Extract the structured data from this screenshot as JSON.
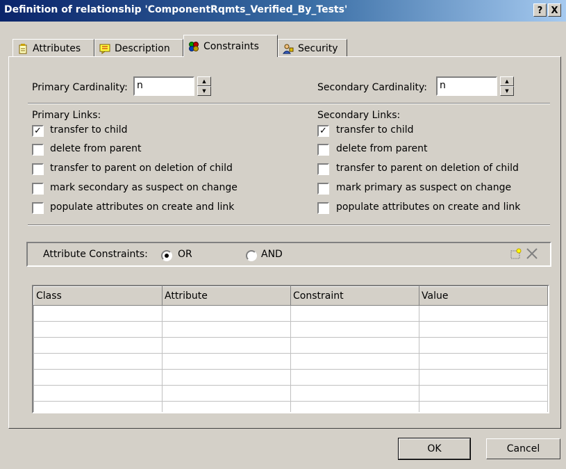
{
  "window": {
    "title": "Definition of relationship 'ComponentRqmts_Verified_By_Tests'",
    "help_label": "?",
    "close_label": "X"
  },
  "tabs": [
    {
      "label": "Attributes",
      "icon": "attributes-icon"
    },
    {
      "label": "Description",
      "icon": "description-icon"
    },
    {
      "label": "Constraints",
      "icon": "constraints-icon",
      "active": true
    },
    {
      "label": "Security",
      "icon": "security-icon"
    }
  ],
  "primary": {
    "cardinality_label": "Primary Cardinality:",
    "cardinality_value": "n",
    "links_label": "Primary Links:",
    "links": [
      {
        "label": "transfer to child",
        "checked": true
      },
      {
        "label": "delete from parent",
        "checked": false
      },
      {
        "label": "transfer to parent on deletion of child",
        "checked": false
      },
      {
        "label": "mark secondary as suspect on change",
        "checked": false
      },
      {
        "label": "populate attributes on create and link",
        "checked": false
      }
    ]
  },
  "secondary": {
    "cardinality_label": "Secondary Cardinality:",
    "cardinality_value": "n",
    "links_label": "Secondary Links:",
    "links": [
      {
        "label": "transfer to child",
        "checked": true
      },
      {
        "label": "delete from parent",
        "checked": false
      },
      {
        "label": "transfer to parent on deletion of child",
        "checked": false
      },
      {
        "label": "mark primary as suspect on change",
        "checked": false
      },
      {
        "label": "populate attributes on create and link",
        "checked": false
      }
    ]
  },
  "attribute_constraints": {
    "label": "Attribute Constraints:",
    "options": [
      {
        "label": "OR",
        "selected": true
      },
      {
        "label": "AND",
        "selected": false
      }
    ]
  },
  "grid": {
    "columns": [
      "Class",
      "Attribute",
      "Constraint",
      "Value"
    ],
    "row_count": 7
  },
  "buttons": {
    "ok": "OK",
    "cancel": "Cancel"
  },
  "colors": {
    "face": "#d4d0c8",
    "title_start": "#0a246a",
    "title_end": "#a6caf0"
  }
}
